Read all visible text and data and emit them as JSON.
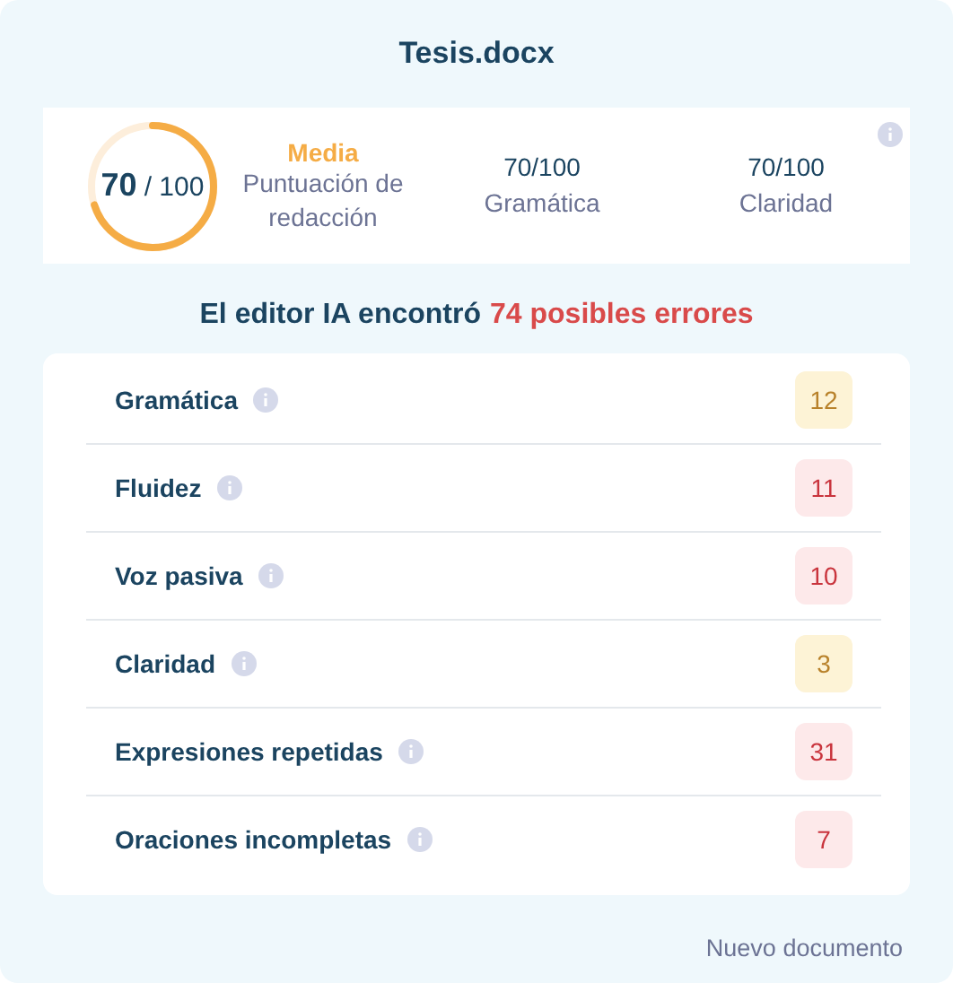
{
  "title": "Tesis.docx",
  "score": {
    "value": "70",
    "max": "/ 100",
    "level": 0.7,
    "rating": "Media",
    "label": "Puntuación de redacción"
  },
  "metrics": [
    {
      "value": "70/100",
      "label": "Gramática"
    },
    {
      "value": "70/100",
      "label": "Claridad"
    }
  ],
  "heading": {
    "text": "El editor IA encontró",
    "highlight": "74 posibles errores"
  },
  "issues": [
    {
      "label": "Gramática",
      "count": "12",
      "kind": "warning"
    },
    {
      "label": "Fluidez",
      "count": "11",
      "kind": "error"
    },
    {
      "label": "Voz pasiva",
      "count": "10",
      "kind": "error"
    },
    {
      "label": "Claridad",
      "count": "3",
      "kind": "warning"
    },
    {
      "label": "Expresiones repetidas",
      "count": "31",
      "kind": "error"
    },
    {
      "label": "Oraciones incompletas",
      "count": "7",
      "kind": "error"
    }
  ],
  "footer_link": "Nuevo documento"
}
